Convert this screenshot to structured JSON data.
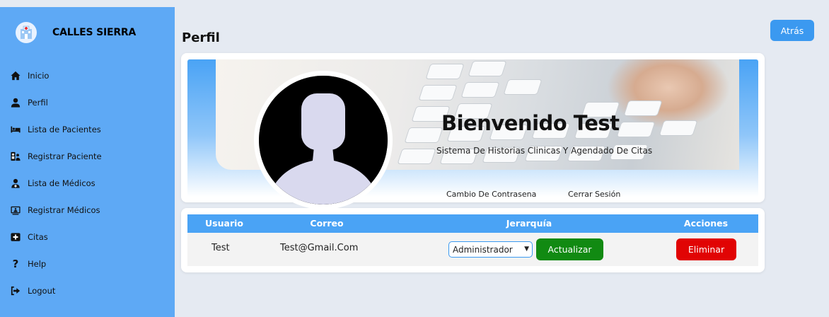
{
  "sidebar": {
    "brand": "CALLES SIERRA",
    "items": [
      {
        "label": "Inicio",
        "icon": "home-icon"
      },
      {
        "label": "Perfil",
        "icon": "user-icon"
      },
      {
        "label": "Lista de Pacientes",
        "icon": "bed-icon"
      },
      {
        "label": "Registrar Paciente",
        "icon": "user-plus-icon"
      },
      {
        "label": "Lista de Médicos",
        "icon": "doctor-icon"
      },
      {
        "label": "Registrar Médicos",
        "icon": "id-card-icon"
      },
      {
        "label": "Citas",
        "icon": "calendar-plus-icon"
      },
      {
        "label": "Help",
        "icon": "question-icon"
      },
      {
        "label": "Logout",
        "icon": "logout-icon"
      }
    ]
  },
  "header": {
    "title": "Perfil",
    "back_label": "Atrás"
  },
  "profile": {
    "welcome": "Bienvenido Test",
    "subtitle": "Sistema De Historias Clinicas Y Agendado De Citas",
    "change_password": "Cambio De Contrasena",
    "logout": "Cerrar Sesión"
  },
  "table": {
    "headers": [
      "Usuario",
      "Correo",
      "Jerarquía",
      "Acciones"
    ],
    "row": {
      "usuario": "Test",
      "correo": "Test@Gmail.Com",
      "jerarquia": "Administrador",
      "update_label": "Actualizar",
      "delete_label": "Eliminar"
    }
  },
  "colors": {
    "sidebar": "#5ea9f5",
    "accent": "#3b99f0",
    "update": "#118a12",
    "delete": "#e10404"
  }
}
